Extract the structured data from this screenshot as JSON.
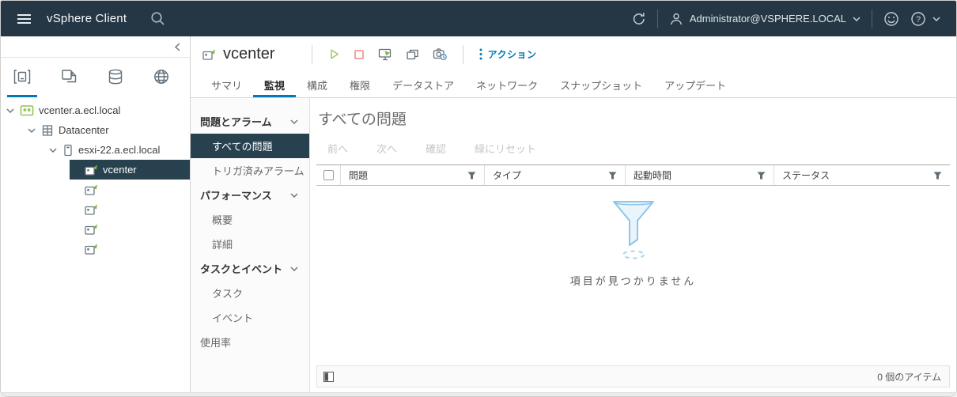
{
  "topbar": {
    "app_title": "vSphere Client",
    "user_menu": "Administrator@VSPHERE.LOCAL"
  },
  "sidebar": {
    "object_tabs": [
      {
        "icon": "hosts-and-clusters-icon",
        "active": true
      },
      {
        "icon": "vms-and-templates-icon",
        "active": false
      },
      {
        "icon": "storage-icon",
        "active": false
      },
      {
        "icon": "networking-icon",
        "active": false
      }
    ],
    "tree": [
      {
        "label": "vcenter.a.ecl.local",
        "icon": "vcenter-icon",
        "level": 0,
        "expander": true,
        "selected": false
      },
      {
        "label": "Datacenter",
        "icon": "datacenter-icon",
        "level": 1,
        "expander": true,
        "selected": false
      },
      {
        "label": "esxi-22.a.ecl.local",
        "icon": "host-icon",
        "level": 2,
        "expander": true,
        "selected": false
      },
      {
        "label": "vcenter",
        "icon": "vm-icon",
        "level": 3,
        "expander": false,
        "selected": true
      },
      {
        "label": "",
        "icon": "vm-icon",
        "level": 3,
        "expander": false,
        "selected": false
      },
      {
        "label": "",
        "icon": "vm-icon",
        "level": 3,
        "expander": false,
        "selected": false
      },
      {
        "label": "",
        "icon": "vm-icon",
        "level": 3,
        "expander": false,
        "selected": false
      },
      {
        "label": "",
        "icon": "vm-icon",
        "level": 3,
        "expander": false,
        "selected": false
      }
    ]
  },
  "object_header": {
    "title": "vcenter",
    "action_icons": [
      "power-on-icon",
      "shutdown-guest-icon",
      "open-console-icon",
      "launch-remote-console-icon",
      "take-snapshot-icon"
    ],
    "actions_label": "アクション"
  },
  "tabs": [
    {
      "label": "サマリ",
      "active": false
    },
    {
      "label": "監視",
      "active": true
    },
    {
      "label": "構成",
      "active": false
    },
    {
      "label": "権限",
      "active": false
    },
    {
      "label": "データストア",
      "active": false
    },
    {
      "label": "ネットワーク",
      "active": false
    },
    {
      "label": "スナップショット",
      "active": false
    },
    {
      "label": "アップデート",
      "active": false
    }
  ],
  "monitor_nav": {
    "sections": [
      {
        "label": "問題とアラーム",
        "chevron": true,
        "top_item": false,
        "children": [
          {
            "label": "すべての問題",
            "selected": true
          },
          {
            "label": "トリガ済みアラーム",
            "selected": false
          }
        ]
      },
      {
        "label": "パフォーマンス",
        "chevron": true,
        "top_item": false,
        "children": [
          {
            "label": "概要",
            "selected": false
          },
          {
            "label": "詳細",
            "selected": false
          }
        ]
      },
      {
        "label": "タスクとイベント",
        "chevron": true,
        "top_item": false,
        "children": [
          {
            "label": "タスク",
            "selected": false
          },
          {
            "label": "イベント",
            "selected": false
          }
        ]
      },
      {
        "label": "使用率",
        "chevron": false,
        "top_item": true,
        "children": []
      }
    ]
  },
  "main": {
    "title": "すべての問題",
    "toolbar": [
      {
        "label": "前へ",
        "enabled": false
      },
      {
        "label": "次へ",
        "enabled": false
      },
      {
        "label": "確認",
        "enabled": false
      },
      {
        "label": "緑にリセット",
        "enabled": false
      }
    ],
    "table": {
      "columns": [
        "問題",
        "タイプ",
        "起動時間",
        "ステータス"
      ],
      "empty_message": "項目が見つかりません",
      "items_count": "0 個のアイテム"
    }
  },
  "colors": {
    "accent": "#0079b8",
    "topbar_bg": "#253745",
    "selection_bg": "#28414e",
    "power_on_green": "#9ccc65",
    "shutdown_red": "#f0897a",
    "empty_funnel_blue": "#8ec5e8"
  }
}
